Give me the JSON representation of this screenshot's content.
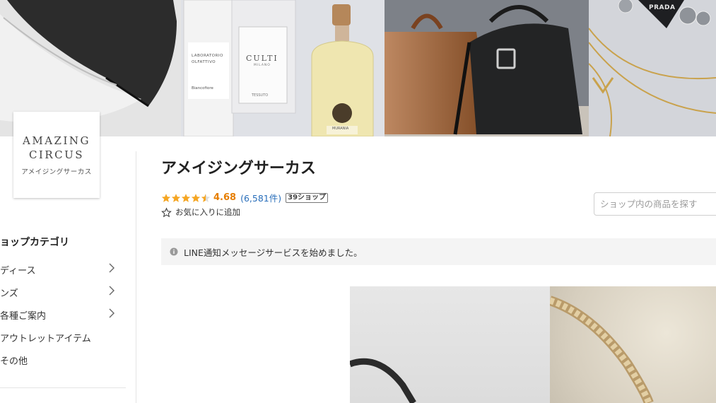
{
  "logo": {
    "line1": "AMAZING",
    "line2": "CIRCUS",
    "sub": "アメイジングサーカス"
  },
  "banner": {
    "bottle_left": {
      "line1": "LABORATORIO",
      "line2": "OLFATTIVO",
      "line3": "Biancofiore"
    },
    "bottle_mid": {
      "brand": "CULTI",
      "city": "MILANO",
      "name": "TESSUTO"
    },
    "bottle_right": {
      "brand": "MURANIA"
    },
    "pendant": "PRADA"
  },
  "shop": {
    "title": "アメイジングサーカス",
    "rating": "4.68",
    "review_count": "(6,581件)",
    "badge": "39ショップ",
    "favorite": "お気に入りに追加",
    "stars_value": 4.5
  },
  "search": {
    "placeholder": "ショップ内の商品を探す"
  },
  "notice": {
    "text": "LINE通知メッセージサービスを始めました。"
  },
  "sidebar": {
    "title": "ョップカテゴリ",
    "items": [
      {
        "label": "ディース",
        "has_children": true
      },
      {
        "label": "ンズ",
        "has_children": true
      },
      {
        "label": "各種ご案内",
        "has_children": true
      },
      {
        "label": "アウトレットアイテム",
        "has_children": false
      },
      {
        "label": "その他",
        "has_children": false
      }
    ]
  },
  "colors": {
    "star": "#f5a623",
    "rating": "#e67e00",
    "link": "#2a6fbb"
  }
}
